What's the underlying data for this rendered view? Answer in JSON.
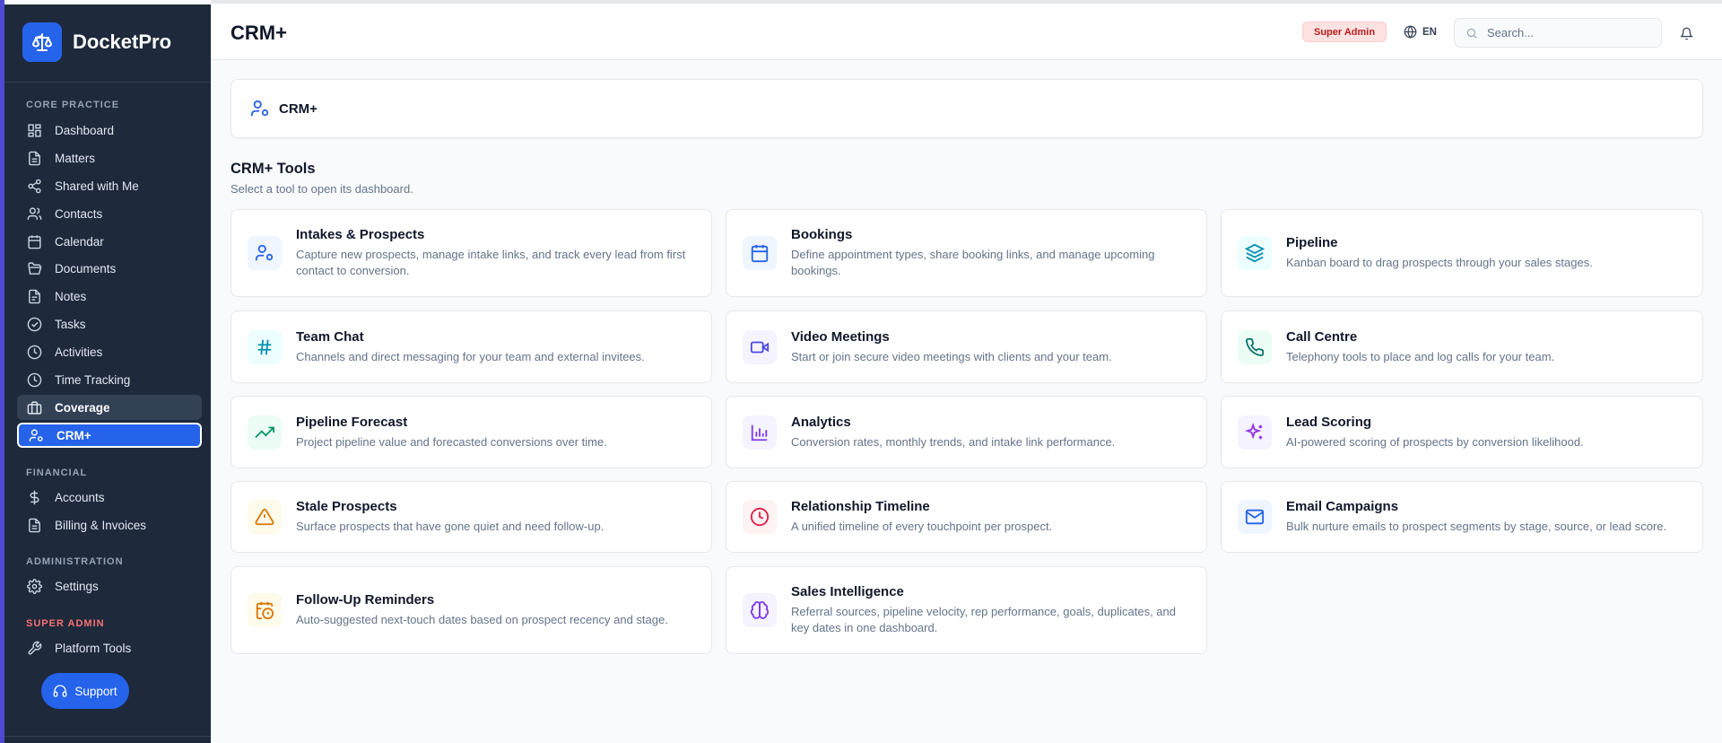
{
  "app": {
    "name": "DocketPro"
  },
  "header": {
    "title": "CRM+",
    "role_badge": "Super Admin",
    "language": "EN",
    "search_placeholder": "Search..."
  },
  "sidebar": {
    "sections": {
      "core": "CORE PRACTICE",
      "financial": "FINANCIAL",
      "administration": "ADMINISTRATION",
      "super_admin": "SUPER ADMIN"
    },
    "items": {
      "dashboard": "Dashboard",
      "matters": "Matters",
      "shared": "Shared with Me",
      "contacts": "Contacts",
      "calendar": "Calendar",
      "documents": "Documents",
      "notes": "Notes",
      "tasks": "Tasks",
      "activities": "Activities",
      "time_tracking": "Time Tracking",
      "coverage": "Coverage",
      "crm": "CRM+",
      "accounts": "Accounts",
      "billing": "Billing & Invoices",
      "settings": "Settings",
      "platform_tools": "Platform Tools"
    },
    "support_label": "Support"
  },
  "main": {
    "card_label": "CRM+",
    "tools_title": "CRM+ Tools",
    "tools_subtitle": "Select a tool to open its dashboard.",
    "tools": {
      "intakes": {
        "name": "Intakes & Prospects",
        "desc": "Capture new prospects, manage intake links, and track every lead from first contact to conversion."
      },
      "bookings": {
        "name": "Bookings",
        "desc": "Define appointment types, share booking links, and manage upcoming bookings."
      },
      "pipeline": {
        "name": "Pipeline",
        "desc": "Kanban board to drag prospects through your sales stages."
      },
      "team_chat": {
        "name": "Team Chat",
        "desc": "Channels and direct messaging for your team and external invitees."
      },
      "video": {
        "name": "Video Meetings",
        "desc": "Start or join secure video meetings with clients and your team."
      },
      "call_centre": {
        "name": "Call Centre",
        "desc": "Telephony tools to place and log calls for your team."
      },
      "forecast": {
        "name": "Pipeline Forecast",
        "desc": "Project pipeline value and forecasted conversions over time."
      },
      "analytics": {
        "name": "Analytics",
        "desc": "Conversion rates, monthly trends, and intake link performance."
      },
      "lead_scoring": {
        "name": "Lead Scoring",
        "desc": "AI-powered scoring of prospects by conversion likelihood."
      },
      "stale": {
        "name": "Stale Prospects",
        "desc": "Surface prospects that have gone quiet and need follow-up."
      },
      "timeline": {
        "name": "Relationship Timeline",
        "desc": "A unified timeline of every touchpoint per prospect."
      },
      "email": {
        "name": "Email Campaigns",
        "desc": "Bulk nurture emails to prospect segments by stage, source, or lead score."
      },
      "followup": {
        "name": "Follow-Up Reminders",
        "desc": "Auto-suggested next-touch dates based on prospect recency and stage."
      },
      "sales_intel": {
        "name": "Sales Intelligence",
        "desc": "Referral sources, pipeline velocity, rep performance, goals, duplicates, and key dates in one dashboard."
      }
    }
  },
  "colors": {
    "sidebar_bg": "#1e293b",
    "accent": "#2563eb",
    "badge_red": "#b91c1c"
  }
}
